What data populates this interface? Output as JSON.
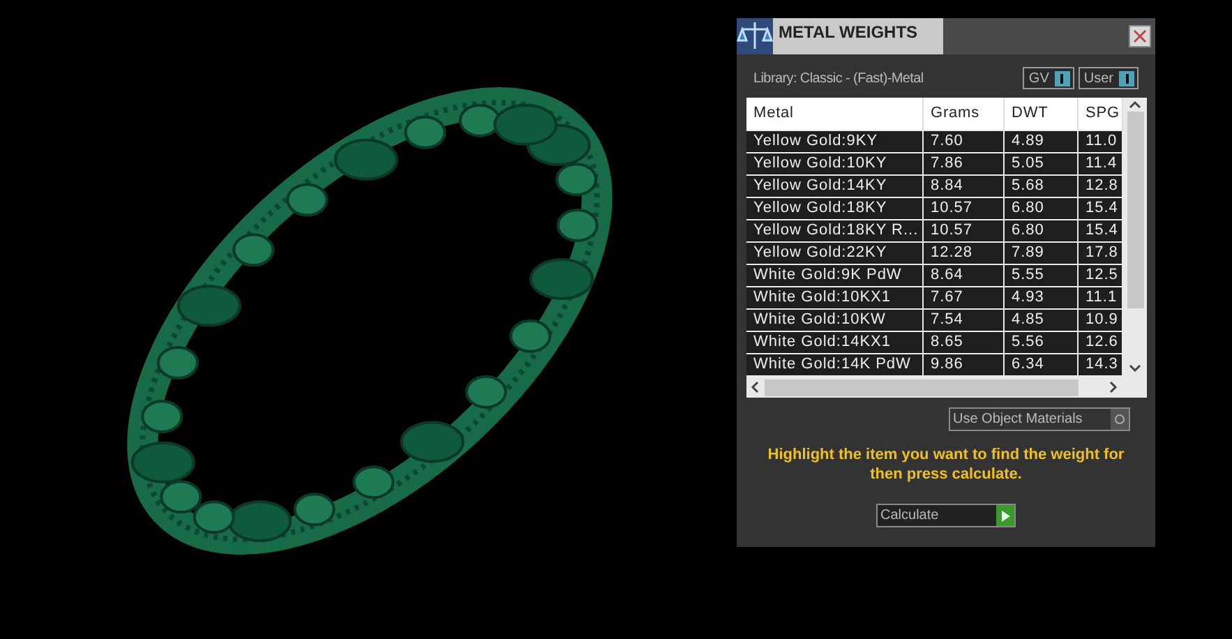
{
  "window": {
    "title": "METAL WEIGHTS"
  },
  "library": "Library: Classic - (Fast)-Metal",
  "toggles": [
    {
      "label": "GV",
      "on": true
    },
    {
      "label": "User",
      "on": true
    }
  ],
  "table": {
    "columns": [
      "Metal",
      "Grams",
      "DWT",
      "SPG"
    ],
    "rows": [
      [
        "Yellow Gold:9KY",
        "7.60",
        "4.89",
        "11.0"
      ],
      [
        "Yellow Gold:10KY",
        "7.86",
        "5.05",
        "11.4"
      ],
      [
        "Yellow Gold:14KY",
        "8.84",
        "5.68",
        "12.8"
      ],
      [
        "Yellow Gold:18KY",
        "10.57",
        "6.80",
        "15.4"
      ],
      [
        "Yellow Gold:18KY R...",
        "10.57",
        "6.80",
        "15.4"
      ],
      [
        "Yellow Gold:22KY",
        "12.28",
        "7.89",
        "17.8"
      ],
      [
        "White Gold:9K PdW",
        "8.64",
        "5.55",
        "12.5"
      ],
      [
        "White Gold:10KX1",
        "7.67",
        "4.93",
        "11.1"
      ],
      [
        "White Gold:10KW",
        "7.54",
        "4.85",
        "10.9"
      ],
      [
        "White Gold:14KX1",
        "8.65",
        "5.56",
        "12.6"
      ],
      [
        "White Gold:14K PdW",
        "9.86",
        "6.34",
        "14.3"
      ]
    ]
  },
  "use_object_materials": {
    "label": "Use Object Materials",
    "on": false
  },
  "instruction": "Highlight the item you want to find the weight for then press calculate.",
  "calculate_button": "Calculate"
}
